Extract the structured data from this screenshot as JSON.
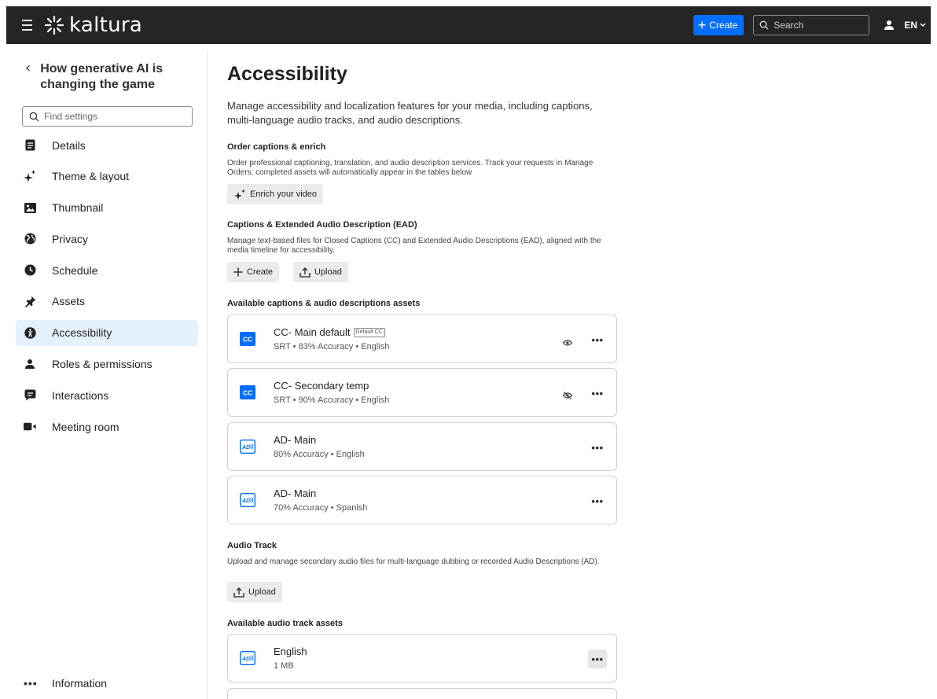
{
  "header": {
    "logo_text": "kaltura",
    "create_label": "Create",
    "search_placeholder": "Search",
    "language": "EN",
    "accent_color": "#006efa"
  },
  "sidebar": {
    "back_title": "How generative AI is changing the game",
    "find_placeholder": "Find settings",
    "items": [
      {
        "label": "Details",
        "icon": "document-icon"
      },
      {
        "label": "Theme & layout",
        "icon": "sparkle-icon"
      },
      {
        "label": "Thumbnail",
        "icon": "image-icon"
      },
      {
        "label": "Privacy",
        "icon": "globe-icon"
      },
      {
        "label": "Schedule",
        "icon": "clock-icon"
      },
      {
        "label": "Assets",
        "icon": "pin-icon"
      },
      {
        "label": "Accessibility",
        "icon": "accessibility-icon",
        "active": true
      },
      {
        "label": "Roles & permissions",
        "icon": "user-icon"
      },
      {
        "label": "Interactions",
        "icon": "chat-icon"
      },
      {
        "label": "Meeting room",
        "icon": "video-camera-icon"
      }
    ],
    "info_label": "Information"
  },
  "main": {
    "title": "Accessibility",
    "description": "Manage accessibility and localization features for your media, including captions, multi-language audio tracks, and audio descriptions.",
    "order": {
      "title": "Order captions & enrich",
      "description": "Order professional captioning, translation, and audio description services. Track your requests in Manage Orders; completed assets will automatically appear in the tables below",
      "button": "Enrich your video"
    },
    "captions": {
      "title": "Captions & Extended Audio Description (EAD)",
      "description": "Manage text-based files for Closed Captions (CC) and Extended Audio Descriptions (EAD), aligned with the media timeline for accessibility.",
      "create_button": "Create",
      "upload_button": "Upload",
      "assets_title": "Available captions & audio descriptions assets",
      "assets": [
        {
          "type": "CC",
          "title": "CC- Main default",
          "tag": "Default CC",
          "subtitle": "SRT • 83% Accuracy • English",
          "visibility": "visible"
        },
        {
          "type": "CC",
          "title": "CC- Secondary temp",
          "tag": "",
          "subtitle": "SRT • 90% Accuracy • English",
          "visibility": "hidden"
        },
        {
          "type": "AD",
          "title": "AD- Main",
          "tag": "",
          "subtitle": "80% Accuracy • English",
          "visibility": ""
        },
        {
          "type": "AD",
          "title": "AD- Main",
          "tag": "",
          "subtitle": "70% Accuracy • Spanish",
          "visibility": ""
        }
      ]
    },
    "audio": {
      "title": "Audio Track",
      "description": "Upload and manage secondary audio files for multi-language dubbing or recorded Audio Descriptions (AD).",
      "upload_button": "Upload",
      "assets_title": "Available audio track assets",
      "assets": [
        {
          "type": "AD",
          "title": "English",
          "subtitle": "1 MB"
        }
      ]
    }
  }
}
